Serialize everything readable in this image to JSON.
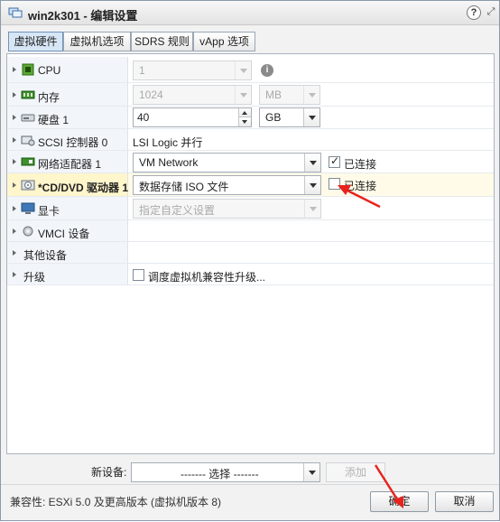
{
  "window": {
    "title": "win2k301 - 编辑设置",
    "help_label": "?",
    "expand_label": "⤢"
  },
  "tabs": [
    {
      "label": "虚拟硬件",
      "active": true
    },
    {
      "label": "虚拟机选项",
      "active": false
    },
    {
      "label": "SDRS 规则",
      "active": false
    },
    {
      "label": "vApp 选项",
      "active": false
    }
  ],
  "rows": {
    "cpu": {
      "name": "CPU",
      "value": "1",
      "info": "i"
    },
    "memory": {
      "name": "内存",
      "value": "1024",
      "unit": "MB"
    },
    "disk": {
      "name": "硬盘 1",
      "value": "40",
      "unit": "GB"
    },
    "scsi": {
      "name": "SCSI 控制器 0",
      "value": "LSI Logic 并行"
    },
    "network": {
      "name": "网络适配器 1",
      "value": "VM Network",
      "connected_label": "已连接",
      "connected": true
    },
    "cdrom": {
      "name": "*CD/DVD 驱动器 1",
      "value": "数据存储 ISO 文件",
      "connected_label": "已连接",
      "connected": false
    },
    "video": {
      "name": "显卡",
      "value": "指定自定义设置"
    },
    "vmci": {
      "name": "VMCI 设备"
    },
    "other": {
      "name": "其他设备"
    },
    "upgrade": {
      "name": "升级",
      "checkbox_label": "调度虚拟机兼容性升级...",
      "checked": false
    }
  },
  "new_device": {
    "label": "新设备:",
    "select_value": "------- 选择 -------",
    "add_label": "添加"
  },
  "footer": {
    "compat": "兼容性: ESXi 5.0 及更高版本 (虚拟机版本 8)",
    "ok_label": "确定",
    "cancel_label": "取消"
  },
  "colors": {
    "accent": "#d7e6f5",
    "annotation_arrow": "#e8231e"
  }
}
